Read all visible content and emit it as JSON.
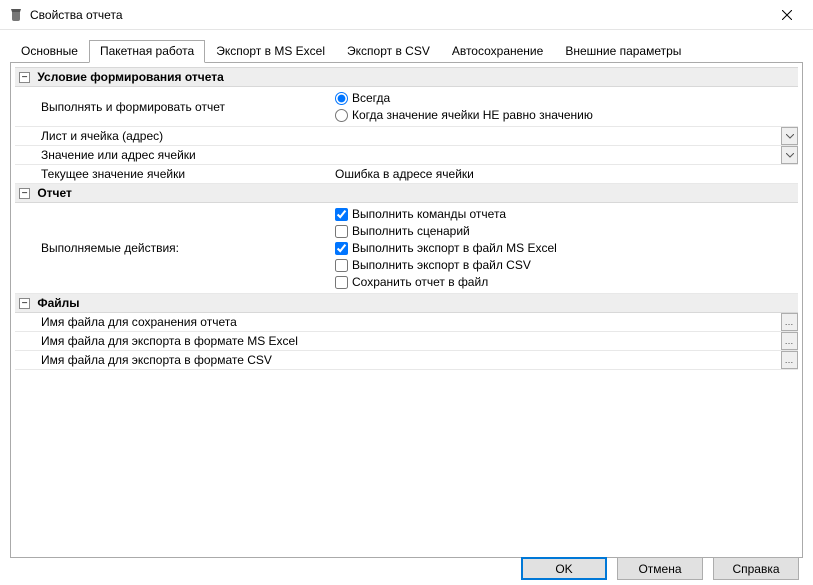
{
  "window": {
    "title": "Свойства отчета"
  },
  "tabs": {
    "t0": "Основные",
    "t1": "Пакетная работа",
    "t2": "Экспорт в MS Excel",
    "t3": "Экспорт в CSV",
    "t4": "Автосохранение",
    "t5": "Внешние параметры"
  },
  "groups": {
    "condition": "Условие формирования отчета",
    "report": "Отчет",
    "files": "Файлы"
  },
  "labels": {
    "runAndForm": "Выполнять и формировать отчет",
    "sheetCell": "Лист и ячейка (адрес)",
    "valueOrAddr": "Значение или адрес ячейки",
    "currentValue": "Текущее значение ячейки",
    "actions": "Выполняемые действия:",
    "fileSave": "Имя файла для сохранения отчета",
    "fileExcel": "Имя файла для экспорта в формате MS Excel",
    "fileCsv": "Имя файла для экспорта в формате CSV"
  },
  "values": {
    "currentValue": "Ошибка в адресе ячейки"
  },
  "radios": {
    "always": "Всегда",
    "whenNotEqual": "Когда значение ячейки НЕ равно значению"
  },
  "checks": {
    "cmds": "Выполнить команды отчета",
    "scenario": "Выполнить сценарий",
    "expExcel": "Выполнить экспорт в файл MS Excel",
    "expCsv": "Выполнить экспорт в файл CSV",
    "saveFile": "Сохранить отчет в файл"
  },
  "buttons": {
    "ok": "OK",
    "cancel": "Отмена",
    "help": "Справка"
  }
}
